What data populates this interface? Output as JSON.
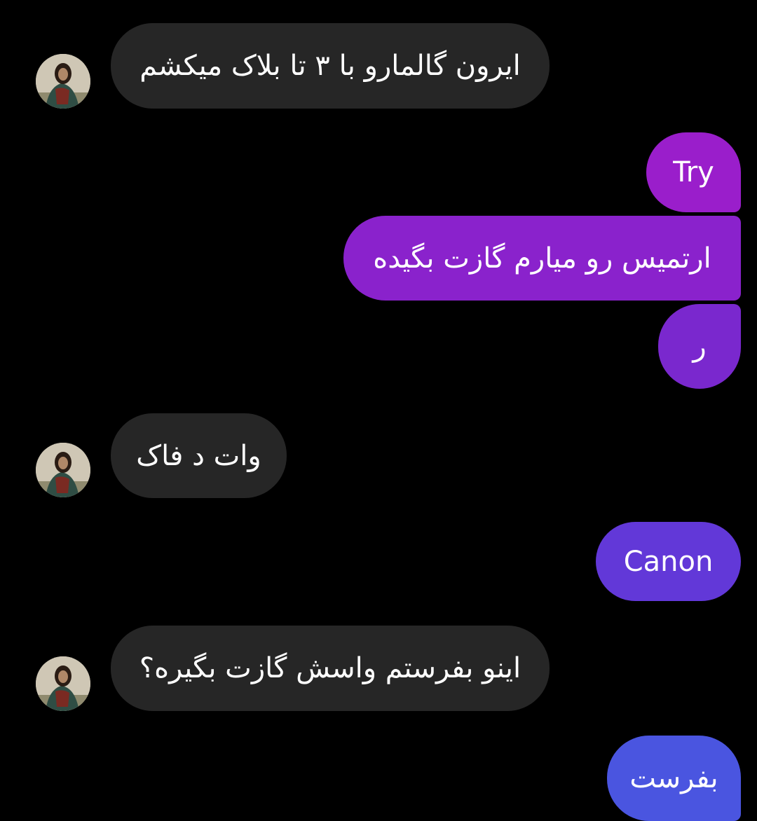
{
  "messages": [
    {
      "id": "m1",
      "direction": "incoming",
      "text": "ایرون گالمارو با ۳ تا بلاک میکشم"
    },
    {
      "id": "m2",
      "direction": "outgoing",
      "text": "Try"
    },
    {
      "id": "m3",
      "direction": "outgoing",
      "text": "ارتمیس رو میارم گازت بگیده"
    },
    {
      "id": "m4",
      "direction": "outgoing",
      "text": "ر"
    },
    {
      "id": "m5",
      "direction": "incoming",
      "text": "وات د فاک"
    },
    {
      "id": "m6",
      "direction": "outgoing",
      "text": "Canon"
    },
    {
      "id": "m7",
      "direction": "incoming",
      "text": "اینو بفرستم واسش گازت بگیره؟"
    },
    {
      "id": "m8",
      "direction": "outgoing",
      "text": "بفرست"
    }
  ],
  "colors": {
    "background": "#000000",
    "incoming_bubble": "#262626",
    "outgoing_gradient_top": "#9b1ec9",
    "outgoing_gradient_bottom": "#4a55e0"
  },
  "icons": {
    "sender_avatar": "profile-photo-avatar-icon"
  }
}
